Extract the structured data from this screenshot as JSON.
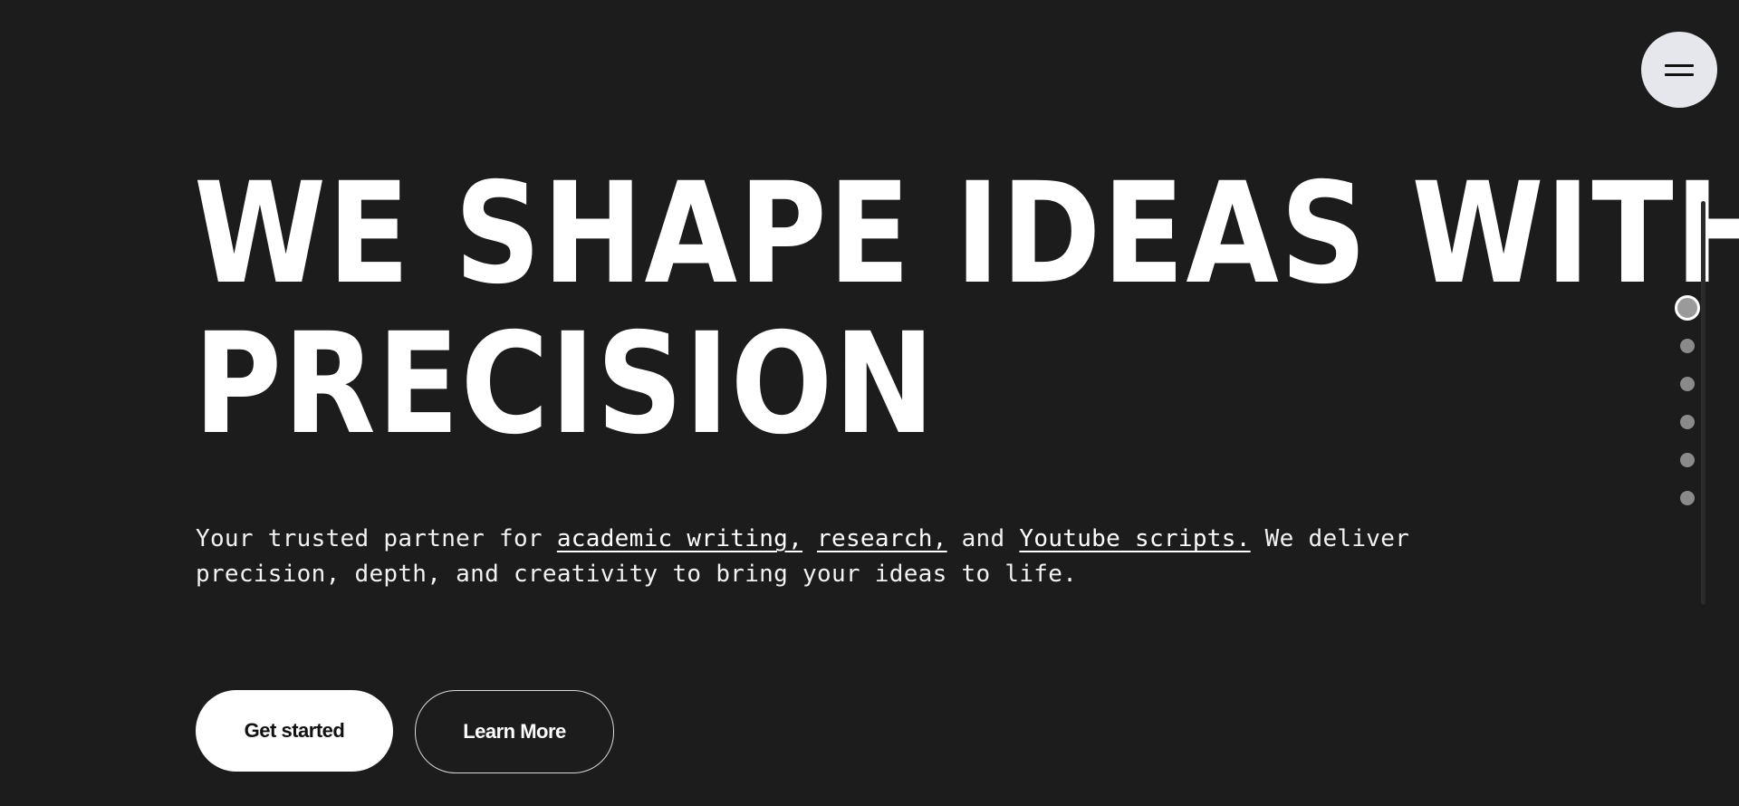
{
  "menu": {
    "icon": "hamburger-menu-icon"
  },
  "hero": {
    "headline_line1": "WE SHAPE IDEAS WITH",
    "headline_line2": "PRECISION",
    "description": {
      "lead": "Your trusted partner for ",
      "link_academic": "academic writing,",
      "link_research": "research,",
      "and_text": " and ",
      "link_youtube": "Youtube scripts.",
      "tail": " We deliver precision, depth, and creativity to bring your ideas to life."
    },
    "primary_button": "Get started",
    "secondary_button": "Learn More"
  },
  "side_nav": {
    "active_index": 0,
    "dot_count": 6
  },
  "colors": {
    "background": "#1c1c1c",
    "text": "#ffffff",
    "menu_button": "#e6e7ec",
    "dot": "#8a8a8a"
  }
}
